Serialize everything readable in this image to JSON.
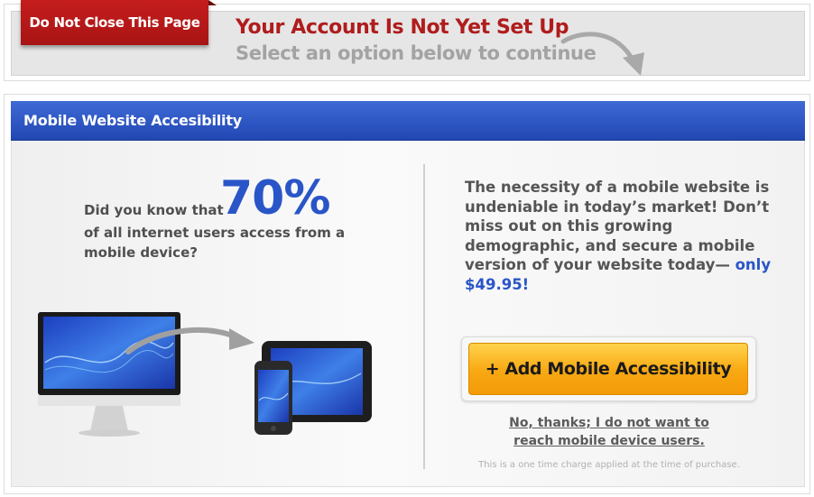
{
  "notice": {
    "tab_label": "Do Not Close This Page",
    "title": "Your Account Is Not Yet Set Up",
    "subtitle": "Select an option below to continue"
  },
  "panel": {
    "title": "Mobile Website Accesibility",
    "stat": {
      "lead": "Did you know that",
      "number": "70%",
      "rest": "of all internet users access from a mobile device?"
    },
    "pitch": {
      "text": "The necessity of a mobile website is undeniable in today’s market! Don’t miss out on this growing demographic, and secure a mobile version of your website today—",
      "price": "only $49.95!"
    },
    "cta_label": "+ Add Mobile Accessibility",
    "decline_label": "No, thanks; I do not want to reach mobile device users.",
    "fine_print": "This is a one time charge applied at the time of purchase."
  },
  "colors": {
    "brand_red": "#b01c1c",
    "header_blue": "#2a55c8",
    "cta_orange": "#f8a812"
  },
  "icons": [
    "curved-arrow-icon",
    "desktop-monitor-icon",
    "tablet-icon",
    "smartphone-icon"
  ]
}
